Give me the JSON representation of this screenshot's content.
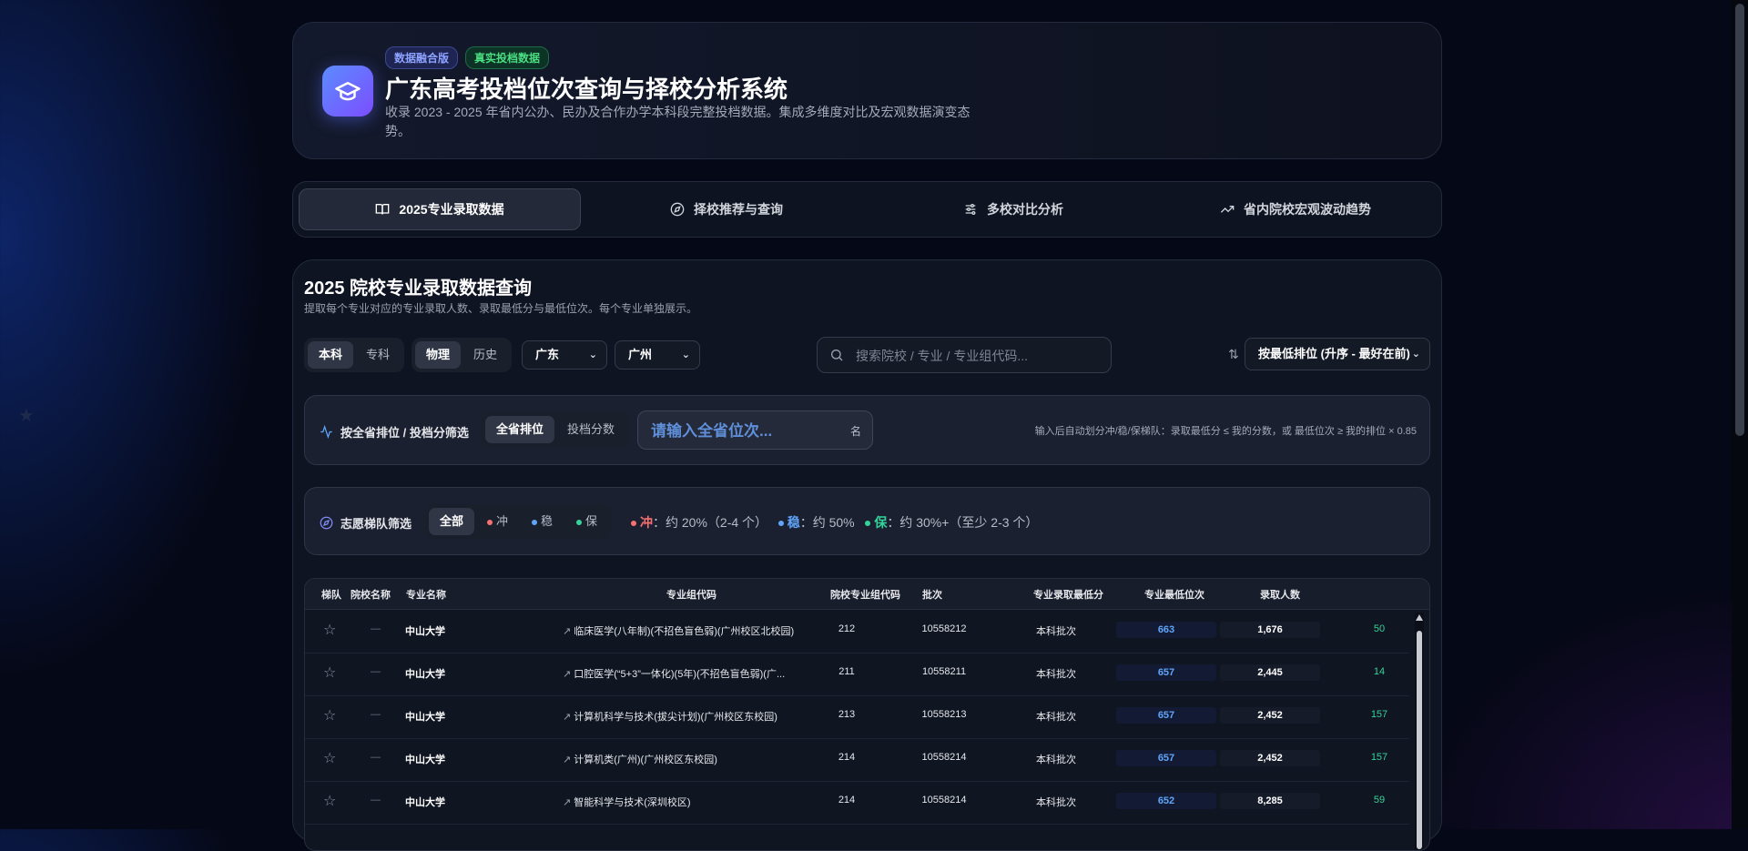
{
  "header": {
    "badges": [
      "数据融合版",
      "真实投档数据"
    ],
    "title": "广东高考投档位次查询与择校分析系统",
    "subtitle": "收录 2023 - 2025 年省内公办、民办及合作办学本科段完整投档数据。集成多维度对比及宏观数据演变态势。"
  },
  "tabs": [
    {
      "label": "2025专业录取数据",
      "icon": "book-icon",
      "active": true
    },
    {
      "label": "择校推荐与查询",
      "icon": "compass-icon",
      "active": false
    },
    {
      "label": "多校对比分析",
      "icon": "sliders-icon",
      "active": false
    },
    {
      "label": "省内院校宏观波动趋势",
      "icon": "trending-up-icon",
      "active": false
    }
  ],
  "section": {
    "title": "2025 院校专业录取数据查询",
    "desc": "提取每个专业对应的专业录取人数、录取最低分与最低位次。每个专业单独展示。"
  },
  "filters": {
    "level": [
      "本科",
      "专科"
    ],
    "subject": [
      "物理",
      "历史"
    ],
    "province": "广东",
    "city": "广州",
    "search_placeholder": "搜索院校 / 专业 / 专业组代码...",
    "sort": "按最低排位 (升序 - 最好在前)"
  },
  "rank_filter": {
    "label": "按全省排位 / 投档分筛选",
    "modes": [
      "全省排位",
      "投档分数"
    ],
    "placeholder": "请输入全省位次...",
    "unit": "名",
    "hint": "输入后自动划分冲/稳/保梯队：录取最低分 ≤ 我的分数，或 最低位次 ≥ 我的排位 × 0.85"
  },
  "tier_filter": {
    "label": "志愿梯队筛选",
    "options": [
      "全部",
      "冲",
      "稳",
      "保"
    ],
    "chong_label": "冲",
    "chong_desc": "：约 20%（2-4 个）",
    "wen_label": "稳",
    "wen_desc": "：约 50%",
    "bao_label": "保",
    "bao_desc": "：约 30%+（至少 2-3 个）",
    "colors": {
      "chong": "#f87171",
      "wen": "#60a5fa",
      "bao": "#34d399"
    }
  },
  "table": {
    "headers": [
      "梯队",
      "院校名称",
      "专业名称",
      "专业组代码",
      "院校专业组代码",
      "批次",
      "专业录取最低分",
      "专业最低位次",
      "录取人数"
    ],
    "rows": [
      {
        "tier": "—",
        "school": "中山大学",
        "major": "临床医学(八年制)(不招色盲色弱)(广州校区北校园)",
        "group": "212",
        "school_group": "10558212",
        "batch": "本科批次",
        "score": "663",
        "rank": "1,676",
        "count": "50"
      },
      {
        "tier": "—",
        "school": "中山大学",
        "major": "口腔医学(“5+3”一体化)(5年)(不招色盲色弱)(广...",
        "group": "211",
        "school_group": "10558211",
        "batch": "本科批次",
        "score": "657",
        "rank": "2,445",
        "count": "14"
      },
      {
        "tier": "—",
        "school": "中山大学",
        "major": "计算机科学与技术(拔尖计划)(广州校区东校园)",
        "group": "213",
        "school_group": "10558213",
        "batch": "本科批次",
        "score": "657",
        "rank": "2,452",
        "count": "157"
      },
      {
        "tier": "—",
        "school": "中山大学",
        "major": "计算机类(广州)(广州校区东校园)",
        "group": "214",
        "school_group": "10558214",
        "batch": "本科批次",
        "score": "657",
        "rank": "2,452",
        "count": "157"
      },
      {
        "tier": "—",
        "school": "中山大学",
        "major": "智能科学与技术(深圳校区)",
        "group": "214",
        "school_group": "10558214",
        "batch": "本科批次",
        "score": "652",
        "rank": "8,285",
        "count": "59"
      }
    ]
  }
}
